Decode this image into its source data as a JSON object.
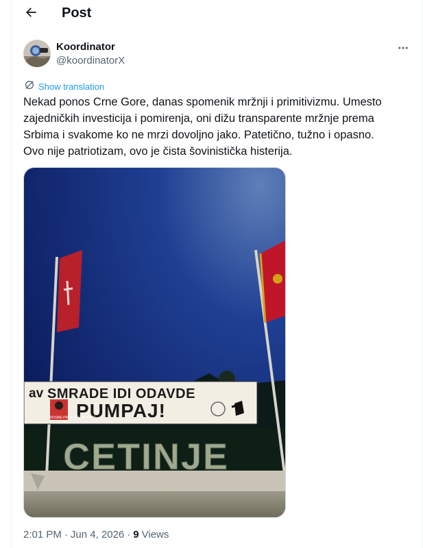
{
  "header": {
    "title": "Post"
  },
  "author": {
    "name": "Koordinator",
    "handle": "@koordinatorX"
  },
  "translate": {
    "label": "Show translation"
  },
  "tweet": {
    "text": "Nekad ponos Crne Gore, danas spomenik mržnji i primitivizmu. Umesto\nzajedničkih investicija i pomirenja, oni dižu transparente mržnje prema\nSrbima i svakome ko ne mrzi dovoljno jako. Patetično, tužno i opasno.\nOvo nije patriotizam, ovo je čista šovinistička histerija."
  },
  "media": {
    "banner_prefix": "av",
    "banner_line1": "SMRADE IDI ODAVDE",
    "banner_line2": "PUMPAJ!",
    "banner_small": "ROSNE PROB\nIMESTI POST",
    "sign": "CETINJE"
  },
  "meta": {
    "time": "2:01 PM",
    "date": "Jun 4, 2026",
    "sep": "·",
    "views_count": "9",
    "views_label": "Views"
  },
  "colors": {
    "accent": "#1d9bf0",
    "muted": "#536471",
    "text": "#0f1419",
    "border": "#cfd9de"
  },
  "icons": {
    "back": "arrow-left-icon",
    "more": "more-horizontal-icon",
    "translate": "globe-icon"
  }
}
